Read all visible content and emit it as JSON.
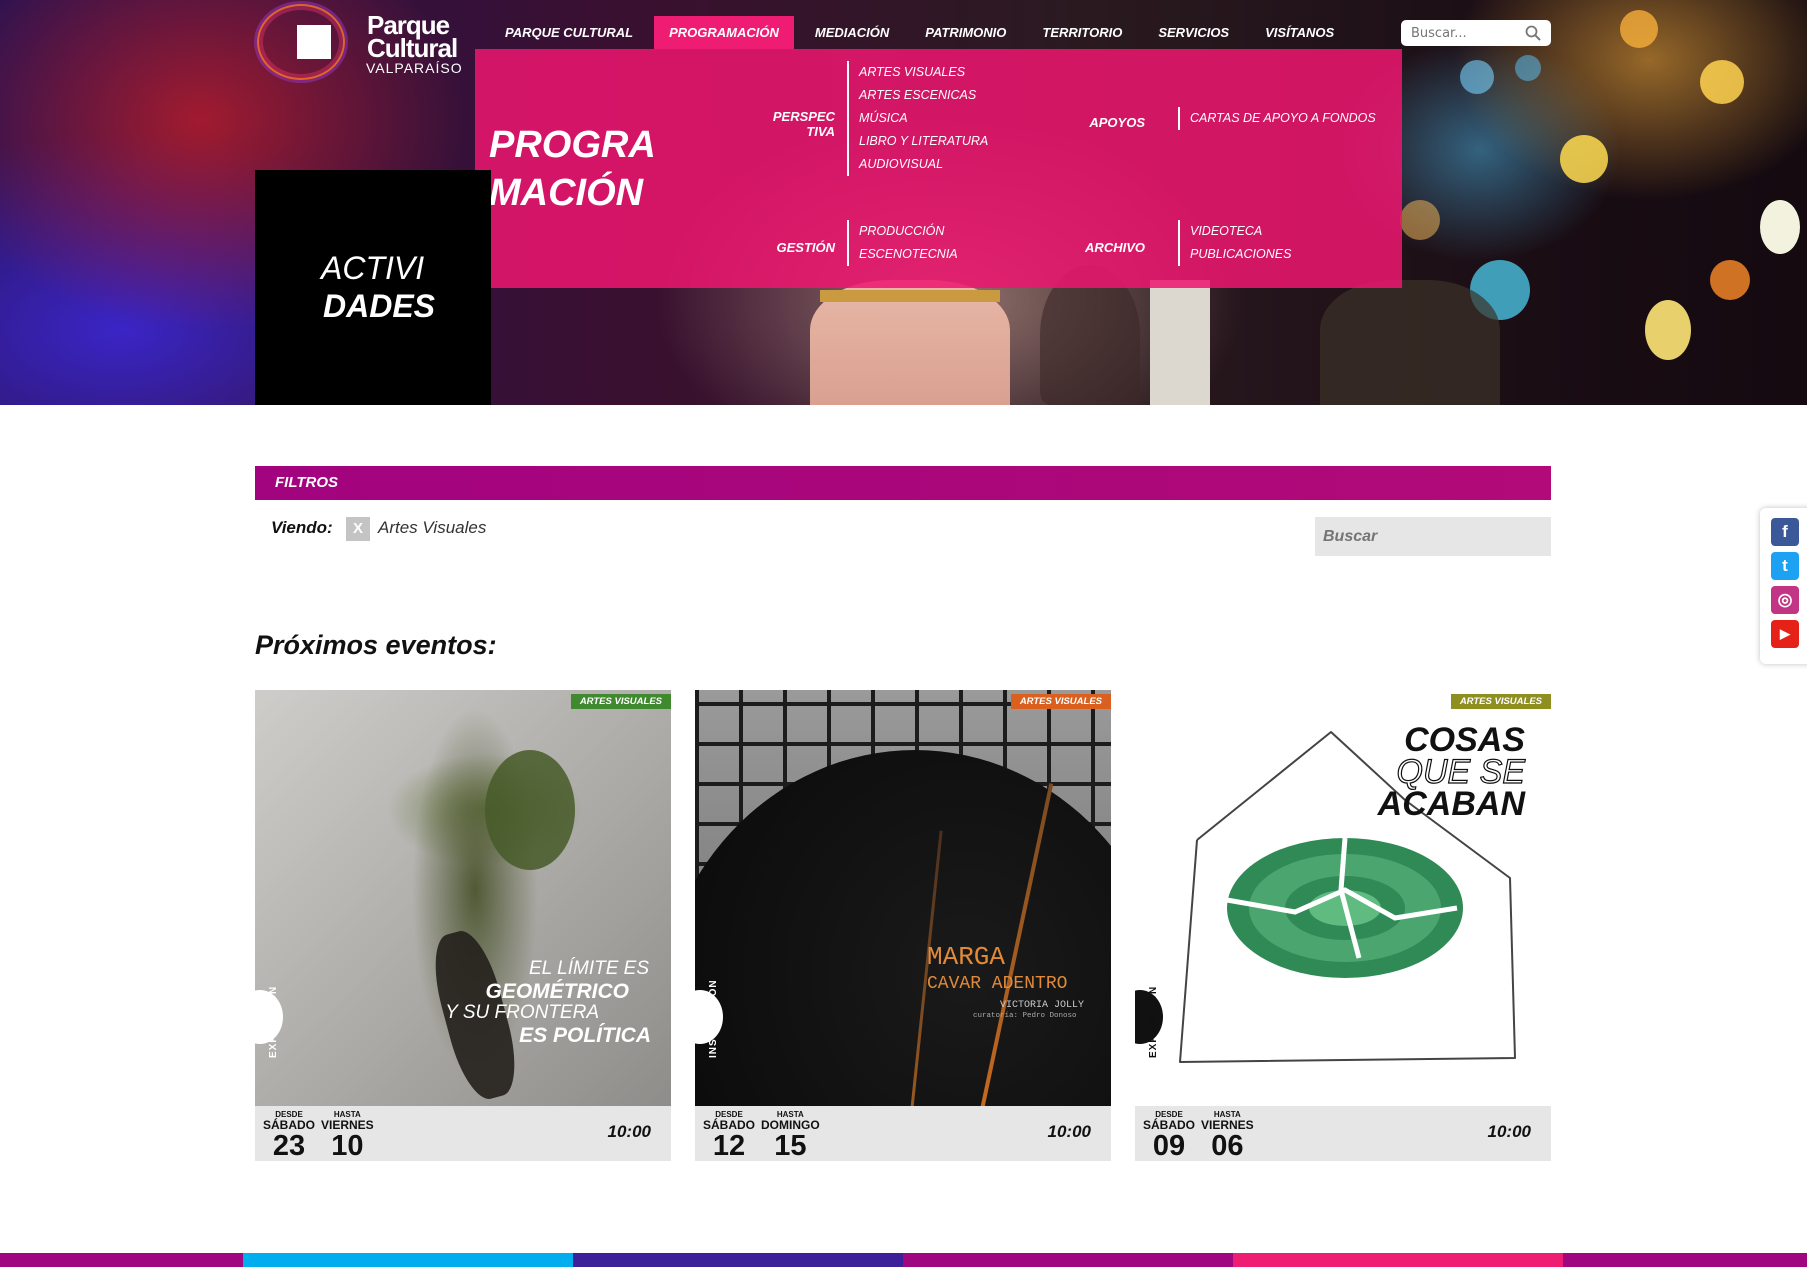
{
  "brand": {
    "line1": "Parque",
    "line2": "Cultural",
    "line3": "VALPARAÍSO"
  },
  "nav": {
    "items": [
      {
        "label": "PARQUE CULTURAL"
      },
      {
        "label": "PROGRAMACIÓN"
      },
      {
        "label": "MEDIACIÓN"
      },
      {
        "label": "PATRIMONIO"
      },
      {
        "label": "TERRITORIO"
      },
      {
        "label": "SERVICIOS"
      },
      {
        "label": "VISÍTANOS"
      }
    ],
    "active_index": 1,
    "search_placeholder": "Buscar..."
  },
  "mega": {
    "title_line1": "PROGRA",
    "title_line2": "MACIÓN",
    "perspectiva": {
      "head1": "PERSPEC",
      "head2": "TIVA",
      "items": [
        "ARTES VISUALES",
        "ARTES ESCENICAS",
        "MÚSICA",
        "LIBRO Y LITERATURA",
        "AUDIOVISUAL"
      ]
    },
    "apoyos": {
      "head": "APOYOS",
      "items": [
        "CARTAS DE APOYO A FONDOS"
      ]
    },
    "gestion": {
      "head": "GESTIÓN",
      "items": [
        "PRODUCCIÓN",
        "ESCENOTECNIA"
      ]
    },
    "archivo": {
      "head": "ARCHIVO",
      "items": [
        "VIDEOTECA",
        "PUBLICACIONES"
      ]
    }
  },
  "section": {
    "line1": "ACTIVI",
    "line2": "DADES"
  },
  "filters": {
    "title": "FILTROS",
    "viewing_label": "Viendo:",
    "remove_label": "X",
    "active_filter": "Artes Visuales",
    "search_placeholder": "Buscar"
  },
  "events_title": "Próximos eventos:",
  "events": [
    {
      "badge": "ARTES VISUALES",
      "badge_color": "#3f8a2e",
      "type": "EXPOSICIÓN",
      "poster": [
        "EL LÍMITE ES",
        "GEOMÉTRICO",
        "Y SU FRONTERA",
        "ES POLÍTICA"
      ],
      "from_label": "DESDE",
      "from_day": "SÁBADO",
      "from_num": "23",
      "to_label": "HASTA",
      "to_day": "VIERNES",
      "to_num": "10",
      "time": "10:00"
    },
    {
      "badge": "ARTES VISUALES",
      "badge_color": "#d9601e",
      "type": "INSTALACIÓN",
      "poster": [
        "MARGA",
        "CAVAR ADENTRO",
        "VICTORIA JOLLY",
        "curatoría: Pedro Donoso"
      ],
      "from_label": "DESDE",
      "from_day": "SÁBADO",
      "from_num": "12",
      "to_label": "HASTA",
      "to_day": "DOMINGO",
      "to_num": "15",
      "time": "10:00"
    },
    {
      "badge": "ARTES VISUALES",
      "badge_color": "#8f8f21",
      "type": "EXPOSICIÓN",
      "poster": [
        "COSAS",
        "QUE SE",
        "ACABAN"
      ],
      "from_label": "DESDE",
      "from_day": "SÁBADO",
      "from_num": "09",
      "to_label": "HASTA",
      "to_day": "VIERNES",
      "to_num": "06",
      "time": "10:00"
    }
  ],
  "social": [
    {
      "name": "facebook",
      "glyph": "f",
      "color": "#3b5998"
    },
    {
      "name": "twitter",
      "glyph": "t",
      "color": "#1da1f2"
    },
    {
      "name": "instagram",
      "glyph": "◎",
      "color": "#c13584"
    },
    {
      "name": "youtube",
      "glyph": "▶",
      "color": "#e62117"
    }
  ],
  "stripe_colors": [
    "#a0067f",
    "#00aeef",
    "#3d1f9a",
    "#a0067f",
    "#ef1c74"
  ]
}
